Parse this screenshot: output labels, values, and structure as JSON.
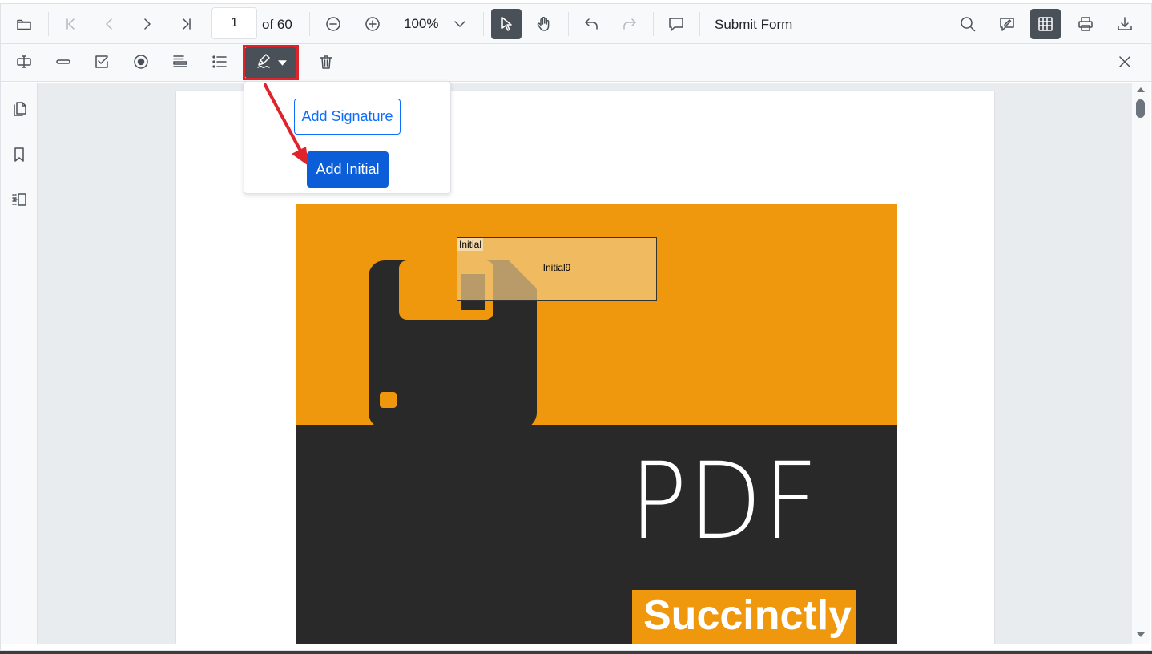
{
  "toolbar": {
    "page_number": "1",
    "page_total": "of 60",
    "zoom_level": "100%",
    "submit_form_label": "Submit Form"
  },
  "signature_menu": {
    "add_signature_label": "Add Signature",
    "add_initial_label": "Add Initial"
  },
  "document": {
    "cover_title": "PDF",
    "cover_subtitle": "Succinctly",
    "initial_field_tag": "Initial",
    "initial_field_name": "Initial9"
  },
  "colors": {
    "accent_orange": "#ef980d",
    "cover_dark": "#292929",
    "primary_blue": "#0b5ed7",
    "highlight_red": "#e0222b"
  },
  "icons": {
    "main_toolbar": [
      "open-folder-icon",
      "first-page-icon",
      "previous-page-icon",
      "next-page-icon",
      "last-page-icon",
      "zoom-out-icon",
      "zoom-in-icon",
      "zoom-dropdown-icon",
      "text-select-icon",
      "pan-icon",
      "undo-icon",
      "redo-icon",
      "comment-icon",
      "search-icon",
      "annotation-edit-icon",
      "form-designer-icon",
      "print-icon",
      "download-icon"
    ],
    "form_toolbar": [
      "textbox-icon",
      "password-icon",
      "checkbox-icon",
      "radio-button-icon",
      "dropdown-list-icon",
      "list-box-icon",
      "signature-icon",
      "delete-icon",
      "close-icon"
    ],
    "sidebar": [
      "page-thumbnails-icon",
      "bookmark-icon",
      "organize-pages-icon"
    ]
  }
}
